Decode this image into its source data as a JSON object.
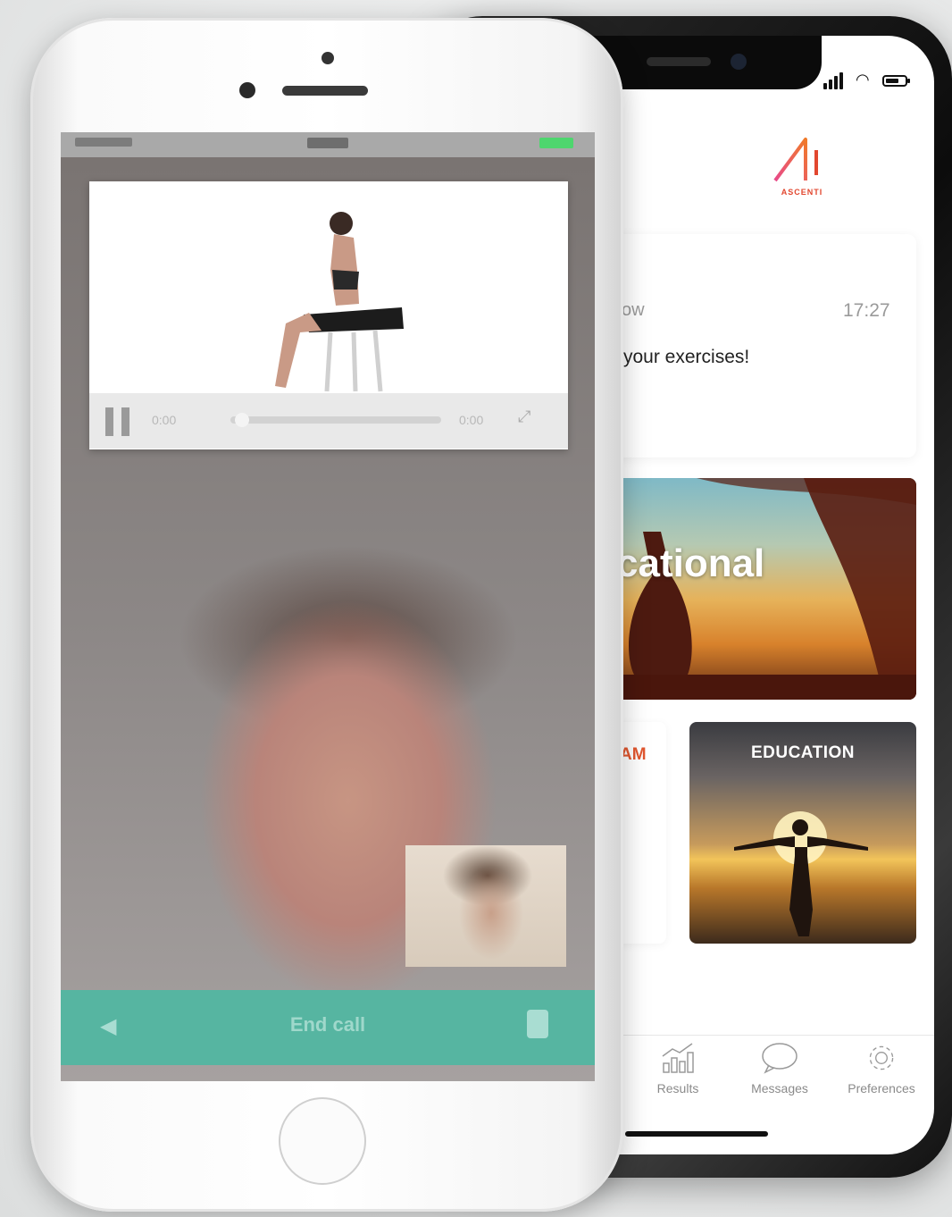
{
  "video_call_phone": {
    "video_player": {
      "elapsed": "0:00",
      "remaining": "0:00",
      "progress_fraction": 0.04
    },
    "call_bar": {
      "end_call_label": "End call"
    }
  },
  "app_phone": {
    "brand": {
      "logo_text": "ASCENTI"
    },
    "message_card": {
      "sender_partial": "ow",
      "time": "17:27",
      "text_partial": "your exercises!"
    },
    "cards": [
      {
        "label": "cational"
      },
      {
        "label": "AM"
      },
      {
        "label": "EDUCATION"
      }
    ],
    "tab_bar": [
      {
        "label": "Results",
        "icon": "chart-icon"
      },
      {
        "label": "Messages",
        "icon": "speech-bubble-icon"
      },
      {
        "label": "Preferences",
        "icon": "gear-icon"
      }
    ]
  },
  "colors": {
    "call_bar": "#56b5a1",
    "brand_accent": "#e2472f"
  }
}
